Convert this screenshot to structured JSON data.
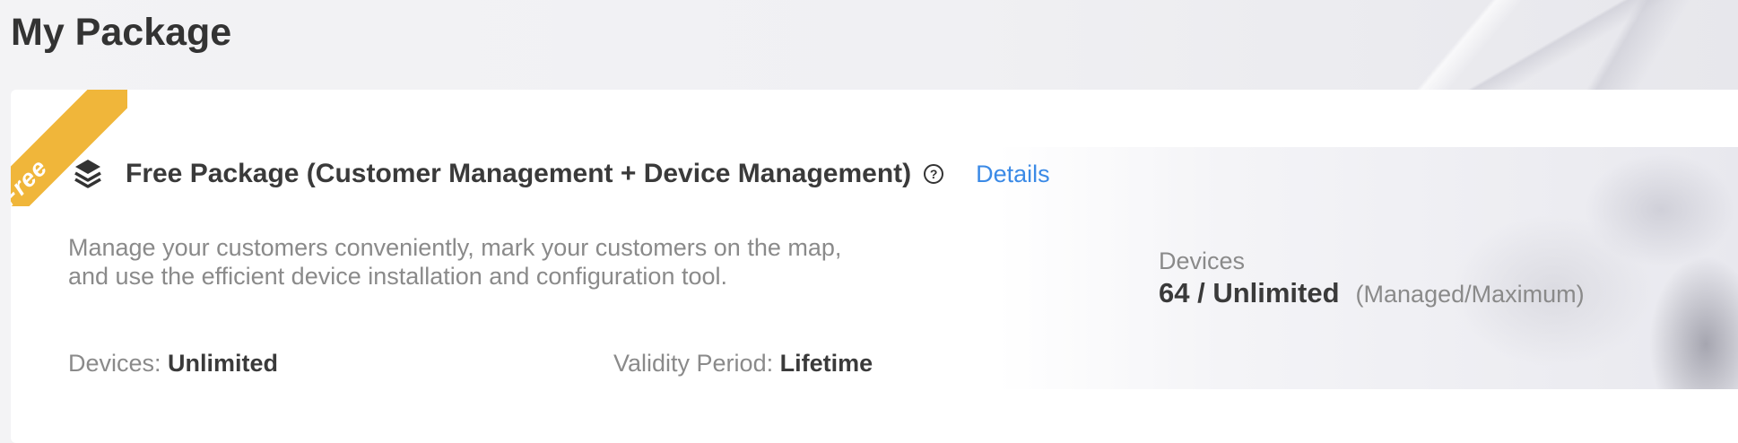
{
  "page": {
    "title": "My Package"
  },
  "package": {
    "ribbon": "Free",
    "title": "Free Package (Customer Management + Device Management)",
    "details_link": "Details",
    "description_line1": "Manage your customers conveniently, mark your customers on the map,",
    "description_line2": "and use the efficient device installation and configuration tool.",
    "devices_label": "Devices:",
    "devices_value": "Unlimited",
    "validity_label": "Validity Period:",
    "validity_value": "Lifetime"
  },
  "usage": {
    "label": "Devices",
    "value": "64 / Unlimited",
    "note": "(Managed/Maximum)"
  },
  "icons": {
    "package": "layers-icon",
    "help": "question-circle-icon"
  },
  "colors": {
    "ribbon": "#f0b63a",
    "link": "#3b8ae6",
    "title": "#333333",
    "muted": "#8a8a8a"
  }
}
